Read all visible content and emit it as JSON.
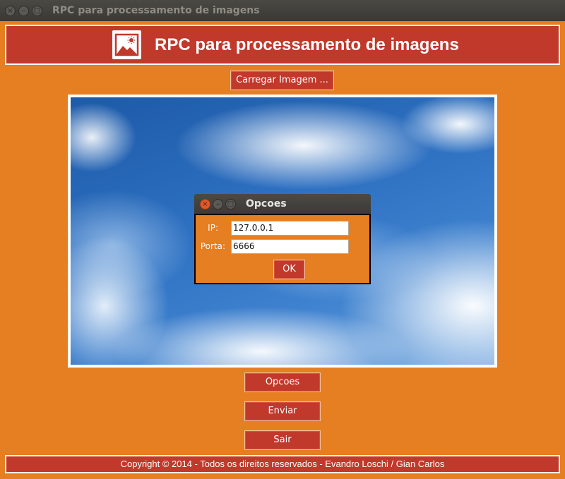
{
  "window": {
    "title": "RPC para processamento de imagens",
    "controls": [
      "close",
      "minimize",
      "maximize"
    ]
  },
  "header": {
    "title": "RPC para processamento de imagens",
    "logo_icon": "image-icon"
  },
  "buttons": {
    "load_image": "Carregar Imagem ...",
    "options": "Opcoes",
    "send": "Enviar",
    "exit": "Sair"
  },
  "footer": {
    "text": "Copyright © 2014 - Todos os direitos reservados - Evandro Loschi / Gian Carlos"
  },
  "dialog": {
    "title": "Opcoes",
    "ip_label": "IP:",
    "ip_value": "127.0.0.1",
    "port_label": "Porta:",
    "port_value": "6666",
    "ok_label": "OK"
  },
  "colors": {
    "background": "#e67e22",
    "accent": "#c0392b",
    "titlebar": "#3c3b37"
  }
}
